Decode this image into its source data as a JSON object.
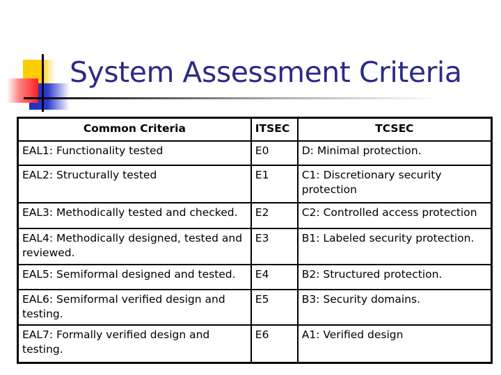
{
  "slide": {
    "title": "System Assessment Criteria"
  },
  "table": {
    "headers": [
      "Common Criteria",
      "ITSEC",
      "TCSEC"
    ],
    "rows": [
      [
        "EAL1: Functionality tested",
        "E0",
        "D: Minimal protection."
      ],
      [
        "EAL2: Structurally tested",
        "E1",
        "C1: Discretionary security protection"
      ],
      [
        "EAL3: Methodically tested and checked.",
        "E2",
        "C2: Controlled access protection"
      ],
      [
        "EAL4: Methodically designed, tested and reviewed.",
        "E3",
        "B1: Labeled security protection."
      ],
      [
        "EAL5: Semiformal designed and tested.",
        "E4",
        "B2: Structured protection."
      ],
      [
        "EAL6: Semiformal verified design and testing.",
        "E5",
        "B3: Security domains."
      ],
      [
        "EAL7: Formally verified design and testing.",
        "E6",
        "A1: Verified design"
      ]
    ]
  },
  "colors": {
    "title": "#2b2b86",
    "accent_yellow": "#ffcc00",
    "accent_red": "#ff2020",
    "accent_blue": "#2030c0"
  }
}
